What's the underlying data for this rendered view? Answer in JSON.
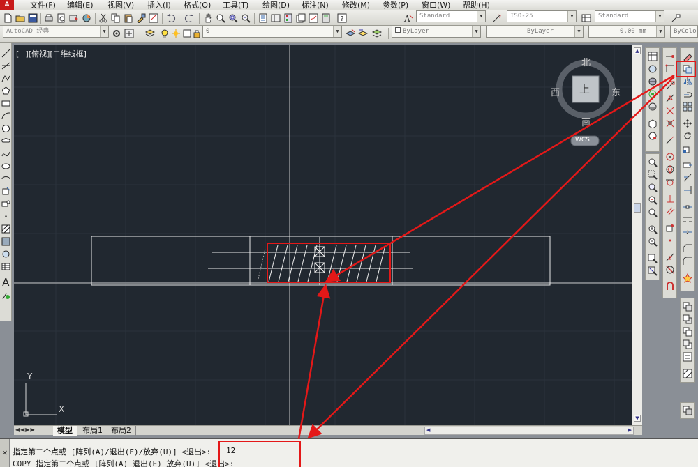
{
  "app": {
    "logo": "A"
  },
  "menu": [
    "文件(F)",
    "编辑(E)",
    "视图(V)",
    "插入(I)",
    "格式(O)",
    "工具(T)",
    "绘图(D)",
    "标注(N)",
    "修改(M)",
    "参数(P)",
    "窗口(W)",
    "帮助(H)"
  ],
  "toolbar": {
    "text_style": "Standard",
    "dim_style": "ISO-25",
    "table_style": "Standard",
    "workspace": "AutoCAD 经典",
    "layer": "0",
    "color": "ByLayer",
    "linetype": "ByLayer",
    "lineweight": "0.00 mm",
    "plotstyle": "ByColo"
  },
  "viewport": {
    "label": "[−][俯视][二维线框]",
    "viewcube": {
      "north": "北",
      "south": "南",
      "west": "西",
      "east": "东",
      "top": "上",
      "wcs": "WCS"
    },
    "ucs": {
      "x": "X",
      "y": "Y"
    }
  },
  "tabs": [
    "模型",
    "布局1",
    "布局2"
  ],
  "command": {
    "prompt": "指定第二个点或 [阵列(A)/退出(E)/放弃(U)] <退出>: ",
    "value": "12",
    "history": "COPY 指定第二个点或 [阵列(A) 退出(E) 放弃(U)] <退出>:"
  },
  "colors": {
    "accent_red": "#e41818",
    "viewport_bg": "#212830"
  },
  "icons": [
    "pan-icon",
    "zoom-icon",
    "line-icon",
    "circle-icon",
    "hatch-icon",
    "text-icon",
    "copy-icon",
    "mirror-icon",
    "move-icon",
    "rotate-icon",
    "trim-icon",
    "erase-icon"
  ]
}
